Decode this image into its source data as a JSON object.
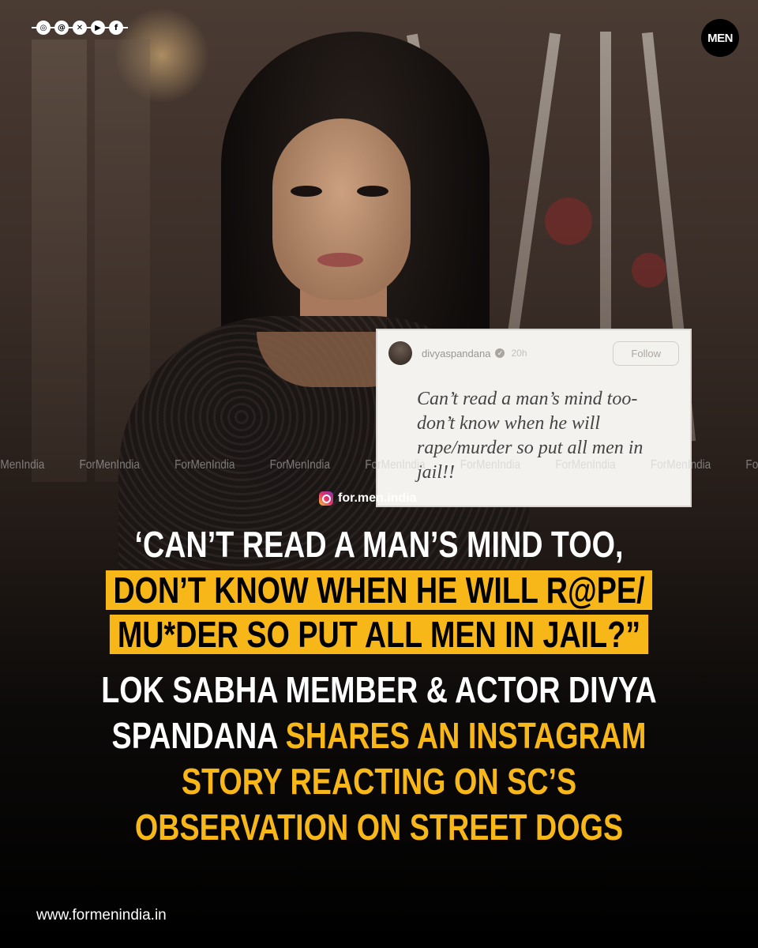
{
  "header": {
    "social_icons": [
      "instagram-icon",
      "threads-icon",
      "x-icon",
      "youtube-icon",
      "facebook-icon"
    ],
    "social_glyphs": [
      "◎",
      "@",
      "✕",
      "▶",
      "f"
    ],
    "brand_logo_text": "MEN"
  },
  "story": {
    "username": "divyaspandana",
    "time": "20h",
    "follow_label": "Follow",
    "text": "Can’t read a man’s mind too- don’t know when he will rape/murder so put all men in jail!!"
  },
  "watermark": {
    "text": "ForMenIndia",
    "instagram_handle": "for.men.india"
  },
  "headline": {
    "line1": "‘CAN’T READ A MAN’S MIND TOO,",
    "line2": "DON’T KNOW WHEN HE WILL R@PE/",
    "line3": "MU*DER SO PUT ALL MEN IN JAIL?”",
    "line4": "LOK SABHA MEMBER & ACTOR DIVYA",
    "line5_white": "SPANDANA ",
    "line5_yellow": "SHARES AN INSTAGRAM",
    "line6": "STORY REACTING ON SC’S",
    "line7": "OBSERVATION ON STREET DOGS"
  },
  "footer": {
    "website": "www.formenindia.in"
  },
  "colors": {
    "accent_yellow": "#f7b718",
    "text_white": "#ffffff",
    "background": "#000000"
  }
}
